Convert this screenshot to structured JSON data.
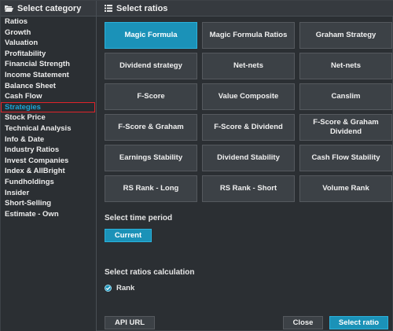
{
  "left_panel": {
    "title": "Select category",
    "categories": [
      "Ratios",
      "Growth",
      "Valuation",
      "Profitability",
      "Financial Strength",
      "Income Statement",
      "Balance Sheet",
      "Cash Flow",
      "Strategies",
      "Stock Price",
      "Technical Analysis",
      "Info & Date",
      "Industry Ratios",
      "Invest Companies",
      "Index & AllBright",
      "Fundholdings",
      "Insider",
      "Short-Selling",
      "Estimate - Own"
    ],
    "active_index": 8
  },
  "right_panel": {
    "title": "Select ratios",
    "ratios": [
      "Magic Formula",
      "Magic Formula Ratios",
      "Graham Strategy",
      "Dividend strategy",
      "Net-nets",
      "Net-nets",
      "F-Score",
      "Value Composite",
      "Canslim",
      "F-Score & Graham",
      "F-Score & Dividend",
      "F-Score & Graham Dividend",
      "Earnings Stability",
      "Dividend Stability",
      "Cash Flow Stability",
      "RS Rank - Long",
      "RS Rank - Short",
      "Volume Rank"
    ],
    "selected_index": 0,
    "time_period": {
      "label": "Select time period",
      "button": "Current"
    },
    "calculation": {
      "label": "Select ratios calculation",
      "option": "Rank"
    },
    "footer": {
      "api_url": "API URL",
      "close": "Close",
      "select": "Select ratio"
    }
  },
  "colors": {
    "accent": "#1b92b8",
    "active_text": "#1aa6d9",
    "highlight_border": "#e0232a",
    "background": "#2b2f33"
  }
}
